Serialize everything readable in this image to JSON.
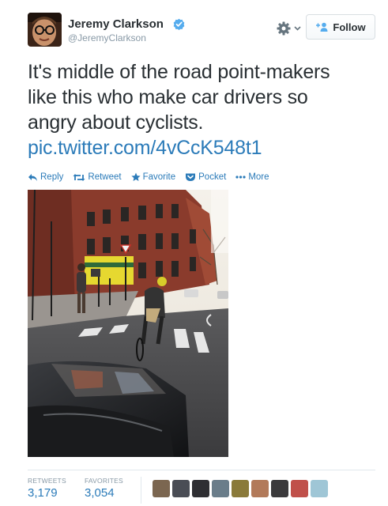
{
  "user": {
    "name": "Jeremy Clarkson",
    "handle": "@JeremyClarkson",
    "verified": true
  },
  "header": {
    "gear_icon": "gear-icon",
    "follow_label": "Follow"
  },
  "tweet": {
    "lines": [
      "It's middle of the road point-makers",
      "like this who make car drivers so",
      "angry about cyclists."
    ],
    "link": "pic.twitter.com/4vCcK548t1"
  },
  "actions": [
    {
      "label": "Reply",
      "icon": "reply-icon"
    },
    {
      "label": "Retweet",
      "icon": "retweet-icon"
    },
    {
      "label": "Favorite",
      "icon": "star-icon"
    },
    {
      "label": "Pocket",
      "icon": "pocket-icon"
    },
    {
      "label": "More",
      "icon": "more-icon"
    }
  ],
  "stats": {
    "retweets_label": "RETWEETS",
    "retweets_value": "3,179",
    "favorites_label": "FAVORITES",
    "favorites_value": "3,054"
  },
  "colors": {
    "link": "#2b7bb9",
    "text": "#292f33",
    "muted": "#8899a6",
    "verified": "#55acee"
  }
}
